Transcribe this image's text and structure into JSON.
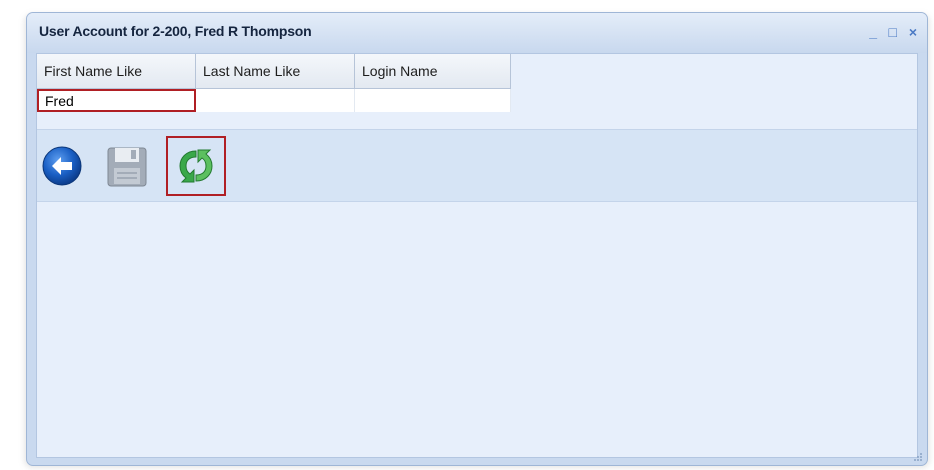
{
  "window": {
    "title": "User Account for 2-200, Fred R Thompson",
    "controls": {
      "minimize": "_",
      "maximize": "□",
      "close": "×"
    }
  },
  "grid": {
    "columns": [
      "First Name Like",
      "Last Name Like",
      "Login Name"
    ],
    "row": {
      "first_name": "Fred",
      "last_name": "",
      "login_name": ""
    }
  },
  "toolbar": {
    "buttons": [
      {
        "name": "back",
        "icon": "back-arrow-icon",
        "color": "#1a5fc4"
      },
      {
        "name": "save",
        "icon": "floppy-disk-icon",
        "color": "#9aa4b0"
      },
      {
        "name": "refresh",
        "icon": "refresh-icon",
        "color": "#3aa84a"
      }
    ]
  },
  "colors": {
    "highlight_border": "#b01f24",
    "window_bg": "#c9d9ef",
    "content_bg": "#e7effb",
    "toolbar_bg": "#d6e4f5"
  }
}
